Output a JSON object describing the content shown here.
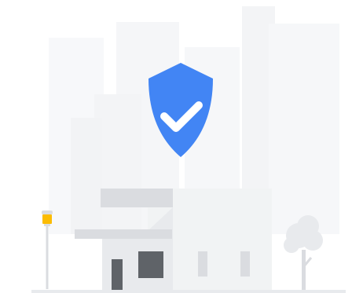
{
  "illustration": {
    "shield": {
      "icon": "shield-check-icon",
      "color": "#4285f4",
      "check_color": "#ffffff"
    },
    "lamp": {
      "icon": "street-lamp-icon",
      "light_color": "#fbbc04"
    },
    "tree": {
      "icon": "tree-icon"
    },
    "palette": {
      "skyline_far": "#f7f8fa",
      "skyline_near": "#f2f3f5",
      "building_wall": "#f1f3f4",
      "building_roof": "#dadce0",
      "door": "#5f6368",
      "window_dark": "#5f6368",
      "window_light": "#dadce0",
      "ground": "#e8eaed"
    }
  }
}
